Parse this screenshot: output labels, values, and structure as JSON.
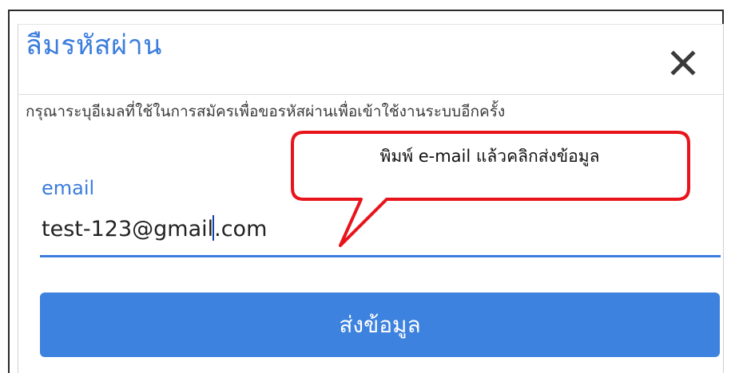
{
  "dialog": {
    "title": "ลืมรหัสผ่าน",
    "close_icon": "close-icon",
    "instruction": "กรุณาระบุอีเมลที่ใช้ในการสมัครเพื่อขอรหัสผ่านเพื่อเข้าใช้งานระบบอีกครั้ง",
    "email_field": {
      "label": "email",
      "value_before_caret": "test-123@gmail",
      "value_after_caret": ".com"
    },
    "submit_label": "ส่งข้อมูล"
  },
  "callout": {
    "text": "พิมพ์ e-mail แล้วคลิกส่งข้อมูล",
    "border_color": "#e8141b"
  },
  "colors": {
    "accent": "#3b7ddd",
    "button": "#3d82de"
  }
}
